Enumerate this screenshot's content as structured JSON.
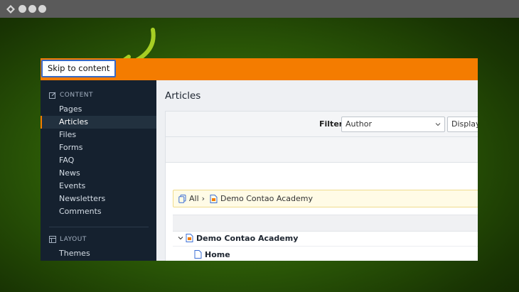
{
  "window": {
    "controls": [
      "close",
      "minimize",
      "maximize"
    ]
  },
  "skip_link": {
    "label": "Skip to content"
  },
  "sidebar": {
    "content_heading": "CONTENT",
    "content_items": [
      {
        "label": "Pages",
        "active": false
      },
      {
        "label": "Articles",
        "active": true
      },
      {
        "label": "Files",
        "active": false
      },
      {
        "label": "Forms",
        "active": false
      },
      {
        "label": "FAQ",
        "active": false
      },
      {
        "label": "News",
        "active": false
      },
      {
        "label": "Events",
        "active": false
      },
      {
        "label": "Newsletters",
        "active": false
      },
      {
        "label": "Comments",
        "active": false
      }
    ],
    "layout_heading": "LAYOUT",
    "layout_items": [
      {
        "label": "Themes",
        "active": false
      }
    ]
  },
  "main": {
    "title": "Articles",
    "filter": {
      "label": "Filter:",
      "author_select": "Author",
      "display_select": "Display i"
    },
    "breadcrumb": {
      "all": "All",
      "separator": "›",
      "current": "Demo Contao Academy"
    },
    "tree": [
      {
        "label": "Demo Contao Academy",
        "level": 0,
        "expanded": true,
        "icon": "root-page-icon"
      },
      {
        "label": "Home",
        "level": 1,
        "expanded": false,
        "icon": "page-icon"
      }
    ]
  },
  "colors": {
    "accent": "#f47c00",
    "sidebar_bg": "#15212f",
    "arrow": "#a6ce24",
    "focus_ring": "#3569c7"
  }
}
